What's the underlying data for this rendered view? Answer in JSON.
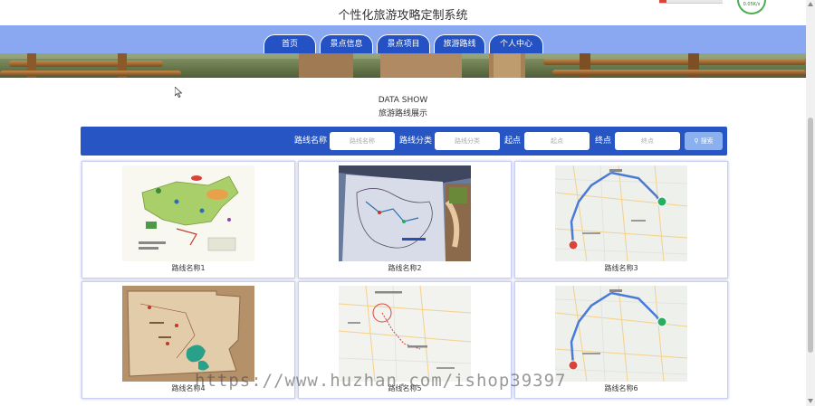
{
  "site": {
    "title": "个性化旅游攻略定制系统",
    "speed_badge": "0.05K/s"
  },
  "nav": {
    "tabs": [
      {
        "label": "首页"
      },
      {
        "label": "景点信息"
      },
      {
        "label": "景点项目"
      },
      {
        "label": "旅游路线"
      },
      {
        "label": "个人中心"
      }
    ]
  },
  "section": {
    "title_en": "DATA SHOW",
    "title_cn": "旅游路线展示"
  },
  "search": {
    "fields": [
      {
        "label": "路线名称",
        "placeholder": "路线名称"
      },
      {
        "label": "路线分类",
        "placeholder": "路线分类"
      },
      {
        "label": "起点",
        "placeholder": "起点"
      },
      {
        "label": "终点",
        "placeholder": "终点"
      }
    ],
    "button_label": "搜索"
  },
  "routes": [
    {
      "name": "路线名称1",
      "image": "illustrated-map-green"
    },
    {
      "name": "路线名称2",
      "image": "hand-drawn-route-map"
    },
    {
      "name": "路线名称3",
      "image": "road-route-map"
    },
    {
      "name": "路线名称4",
      "image": "parchment-map"
    },
    {
      "name": "路线名称5",
      "image": "city-map-red-circle"
    },
    {
      "name": "路线名称6",
      "image": "road-route-map"
    }
  ],
  "watermark": "https://www.huzhan.com/ishop39397"
}
